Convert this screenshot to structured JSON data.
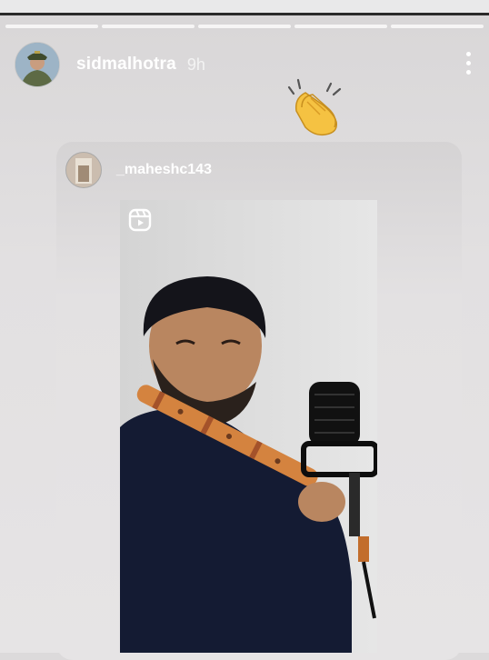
{
  "story": {
    "username": "sidmalhotra",
    "time_ago": "9h",
    "segments": 5,
    "reaction_icon": "clapping-hands-icon"
  },
  "shared_post": {
    "username": "_maheshc143",
    "media_icon": "reels-icon"
  },
  "colors": {
    "background": "#e2e0e1",
    "text": "#ffffff",
    "sweater": "#141b33",
    "flute": "#d4833f"
  }
}
